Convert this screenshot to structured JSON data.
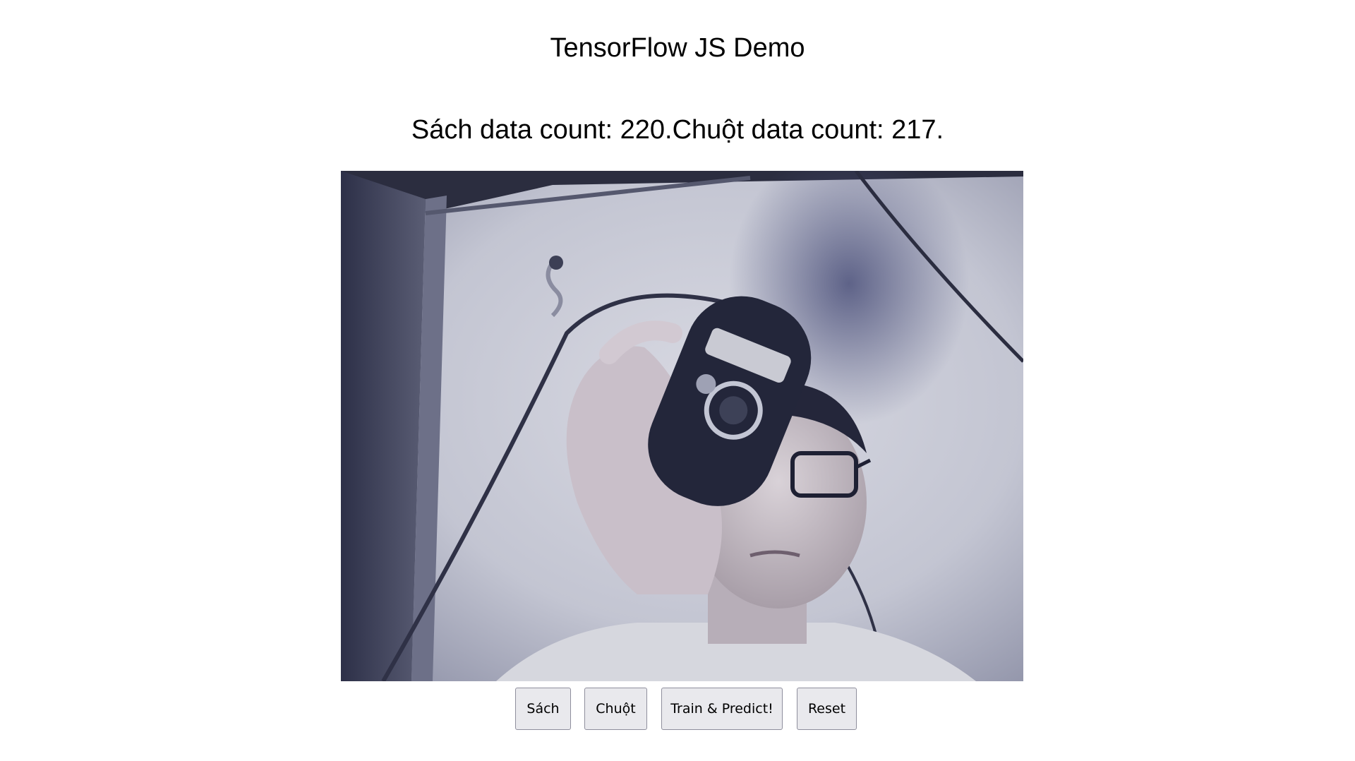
{
  "header": {
    "title": "TensorFlow JS Demo"
  },
  "status": {
    "text": "Sách data count: 220.Chuột data count: 217."
  },
  "webcam": {
    "description_icon": "webcam-feed"
  },
  "controls": {
    "sach_label": "Sách",
    "chuot_label": "Chuột",
    "train_label": "Train & Predict!",
    "reset_label": "Reset"
  },
  "colors": {
    "background": "#ffffff",
    "button_bg": "#e9e9ed",
    "button_border": "#8f8f9d"
  }
}
